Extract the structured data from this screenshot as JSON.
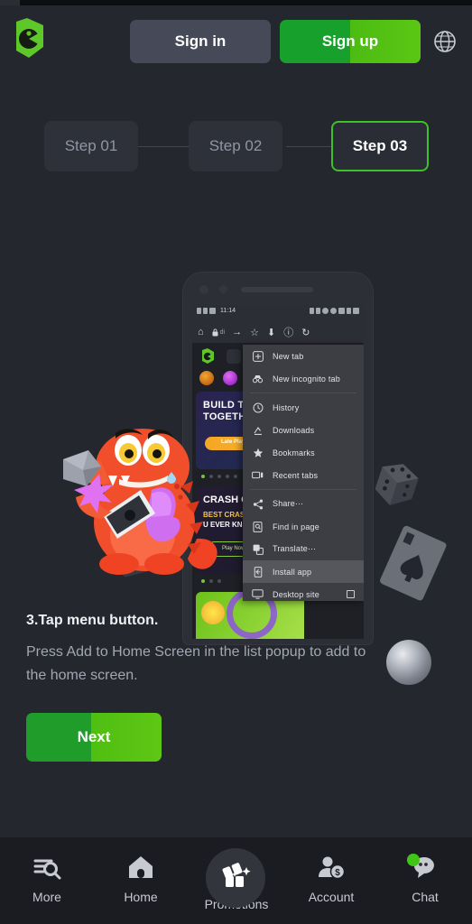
{
  "header": {
    "logo_alt": "brand-logo",
    "sign_in": "Sign in",
    "sign_up": "Sign up",
    "language_icon": "globe-icon"
  },
  "steps": {
    "items": [
      {
        "label": "Step 01",
        "active": false
      },
      {
        "label": "Step 02",
        "active": false
      },
      {
        "label": "Step 03",
        "active": true
      }
    ],
    "active_index": 2,
    "active_border_color": "#3cc226"
  },
  "phone": {
    "status_bar": {
      "time": "11:14"
    },
    "browser_toolbar": {
      "home_icon": "home-icon",
      "lock_icon": "lock-icon",
      "url_text": "di",
      "forward_icon": "arrow-forward-icon",
      "bookmark_icon": "star-icon",
      "download_icon": "download-icon",
      "info_icon": "info-icon",
      "reload_icon": "reload-icon"
    },
    "page_content": {
      "banner1_title": "BUILD TH\nTOGETH",
      "banner1_button": "Late Plays",
      "banner2_title": "CRASH G",
      "banner2_sub1": "BEST CRAS",
      "banner2_sub2": "U EVER KN",
      "banner2_button": "Play Now"
    },
    "menu": {
      "items": [
        {
          "label": "New tab",
          "icon": "plus-box-icon",
          "selected": false,
          "checkbox": false
        },
        {
          "label": "New incognito tab",
          "icon": "incognito-icon",
          "selected": false,
          "checkbox": false
        },
        {
          "separator": true
        },
        {
          "label": "History",
          "icon": "history-icon",
          "selected": false,
          "checkbox": false
        },
        {
          "label": "Downloads",
          "icon": "download-icon",
          "selected": false,
          "checkbox": false
        },
        {
          "label": "Bookmarks",
          "icon": "star-icon",
          "selected": false,
          "checkbox": false
        },
        {
          "label": "Recent tabs",
          "icon": "recent-tabs-icon",
          "selected": false,
          "checkbox": false
        },
        {
          "separator": true
        },
        {
          "label": "Share⋯",
          "icon": "share-icon",
          "selected": false,
          "checkbox": false
        },
        {
          "label": "Find in page",
          "icon": "find-in-page-icon",
          "selected": false,
          "checkbox": false
        },
        {
          "label": "Translate⋯",
          "icon": "translate-icon",
          "selected": false,
          "checkbox": false
        },
        {
          "label": "Install app",
          "icon": "install-app-icon",
          "selected": true,
          "checkbox": false
        },
        {
          "label": "Desktop site",
          "icon": "desktop-icon",
          "selected": false,
          "checkbox": true
        }
      ]
    }
  },
  "decorations": {
    "mascot": "red-dragon-mascot",
    "card_left": "playing-card-icon",
    "card_right": "playing-card-spade-icon",
    "dice": "dice-icon",
    "ball": "billiard-ball-icon"
  },
  "instructions": {
    "title": "3.Tap menu button.",
    "body": "Press Add to Home Screen in the list popup to add to the home screen.",
    "next_button": "Next"
  },
  "bottom_nav": {
    "items": [
      {
        "label": "More",
        "icon": "search-list-icon",
        "active": false,
        "badge": false
      },
      {
        "label": "Home",
        "icon": "home-icon",
        "active": false,
        "badge": false
      },
      {
        "label": "Promotions",
        "icon": "gift-icon",
        "active": false,
        "badge": false
      },
      {
        "label": "Account",
        "icon": "account-money-icon",
        "active": false,
        "badge": false
      },
      {
        "label": "Chat",
        "icon": "chat-icon",
        "active": false,
        "badge": true
      }
    ],
    "badge_color": "#3fc417"
  },
  "colors": {
    "background": "#25272e",
    "accent_green": "#3cc226",
    "bottom_nav_bg": "#1b1c21",
    "signin_bg": "#464a58"
  }
}
